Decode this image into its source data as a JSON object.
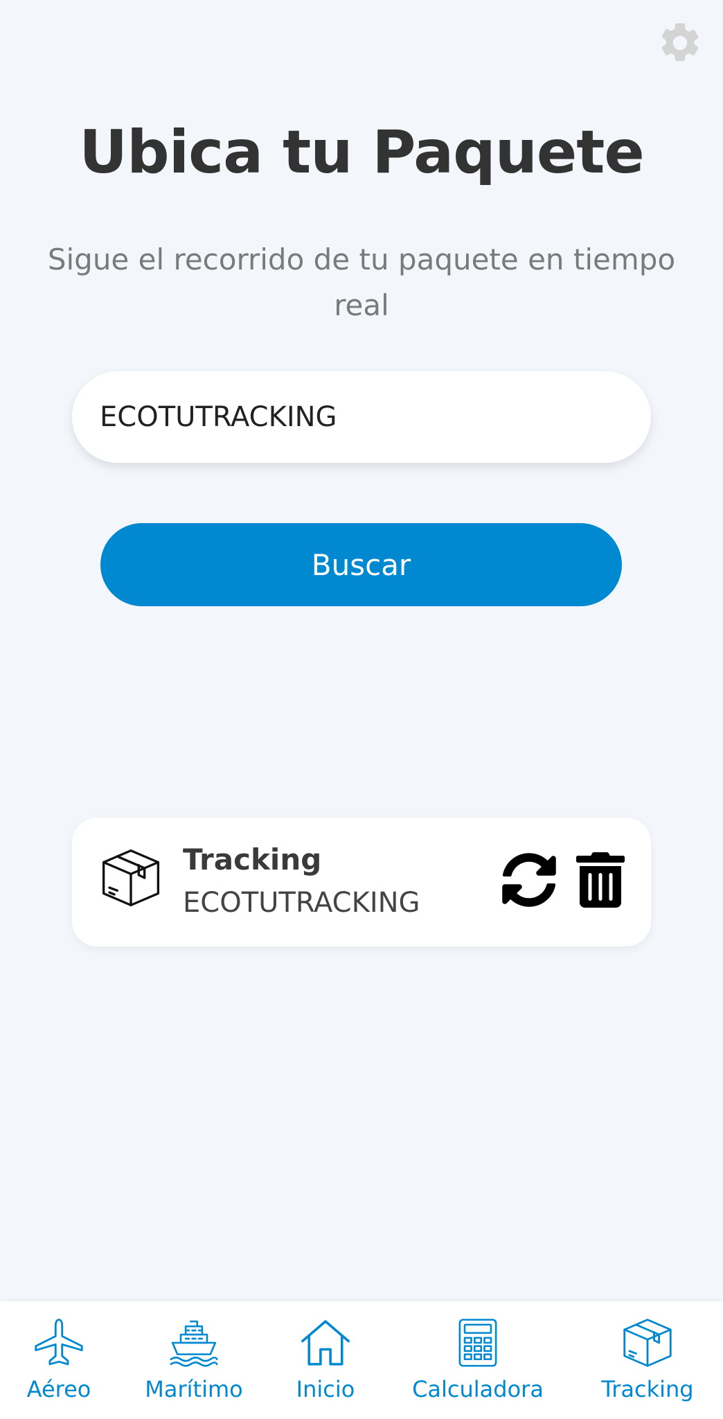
{
  "header": {
    "settings_icon": "gear-icon",
    "title": "Ubica tu Paquete",
    "subtitle": "Sigue el recorrido de tu paquete en tiempo real"
  },
  "search": {
    "value": "ECOTUTRACKING",
    "button_label": "Buscar"
  },
  "tracking_card": {
    "icon": "package-box-icon",
    "title": "Tracking",
    "code": "ECOTUTRACKING",
    "actions": [
      "refresh-icon",
      "trash-icon"
    ]
  },
  "bottom_nav": {
    "items": [
      {
        "label": "Aéreo",
        "icon": "airplane-icon"
      },
      {
        "label": "Marítimo",
        "icon": "ship-icon"
      },
      {
        "label": "Inicio",
        "icon": "home-icon"
      },
      {
        "label": "Calculadora",
        "icon": "calculator-icon"
      },
      {
        "label": "Tracking",
        "icon": "package-box-icon"
      }
    ]
  },
  "colors": {
    "accent": "#0088d1",
    "background": "#f3f6fb",
    "title_text": "#333333",
    "subtitle_text": "#7a7a7a",
    "settings_icon": "#d4d4d4"
  }
}
